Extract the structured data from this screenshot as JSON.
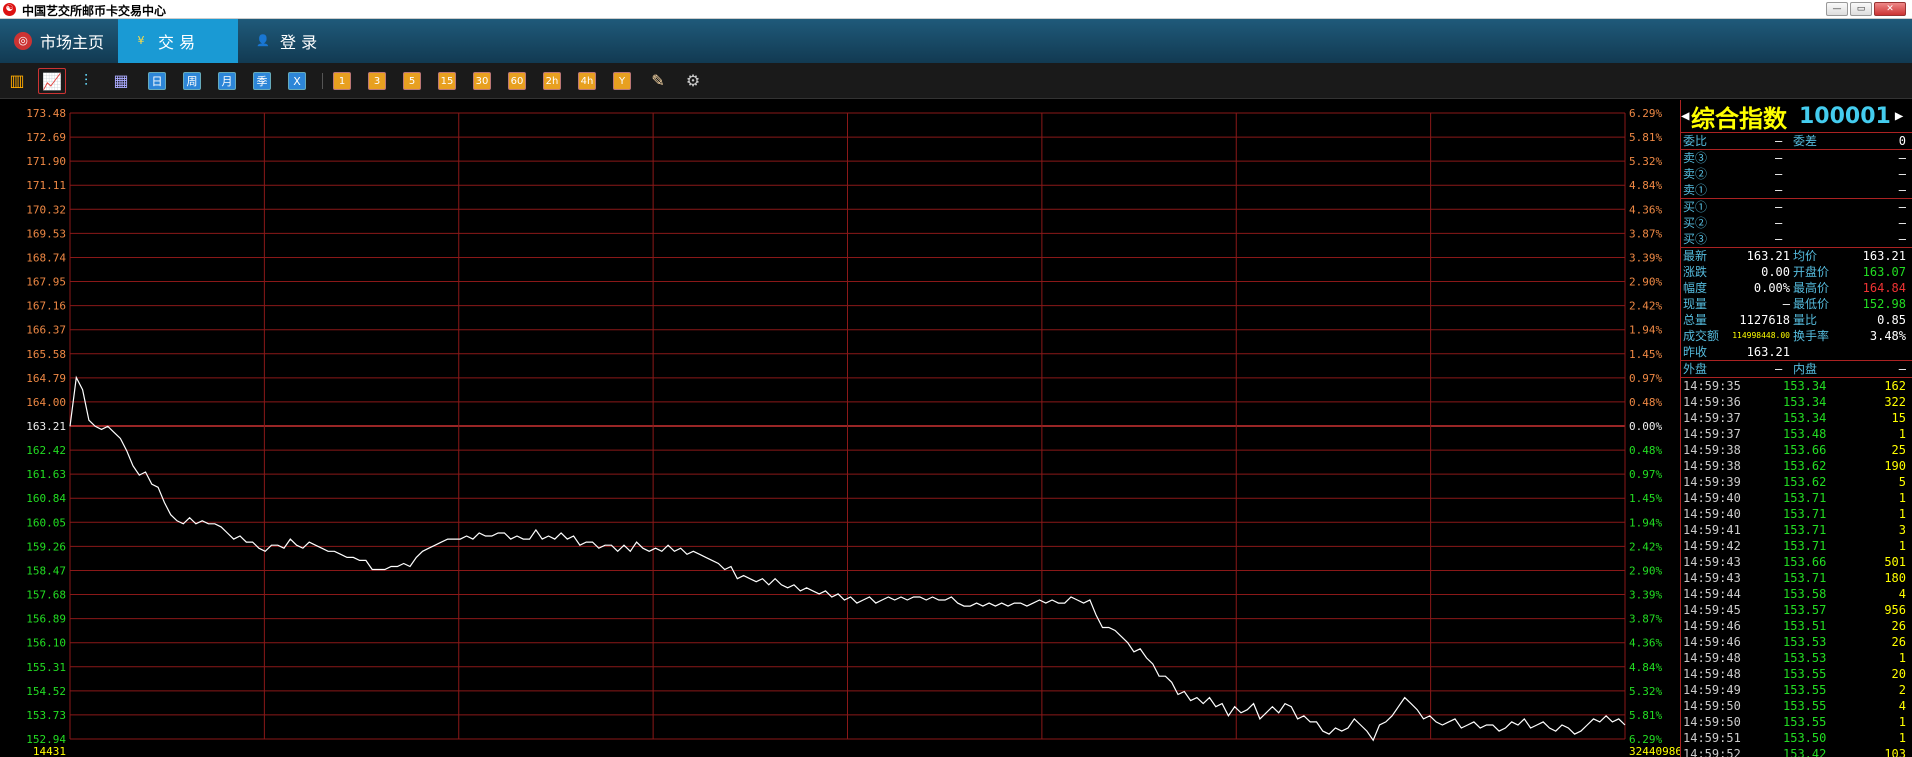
{
  "window": {
    "title": "中国艺交所邮币卡交易中心",
    "buttons": [
      "—",
      "▭",
      "✕"
    ]
  },
  "nav": {
    "items": [
      {
        "label": "市场主页",
        "icon": "market-icon",
        "active": false
      },
      {
        "label": "交 易",
        "icon": "yen-icon",
        "active": true
      },
      {
        "label": "登 录",
        "icon": "user-icon",
        "active": false
      }
    ]
  },
  "toolbar": {
    "icons": [
      {
        "name": "bar-chart-icon",
        "glyph": "▥"
      },
      {
        "name": "line-chart-icon",
        "glyph": "📈",
        "selected": true
      },
      {
        "name": "candlestick-icon",
        "glyph": "⫶"
      },
      {
        "name": "calendar-icon",
        "glyph": "▦"
      }
    ],
    "periods": [
      "日",
      "周",
      "月",
      "季",
      "X"
    ],
    "minutes": [
      "1",
      "3",
      "5",
      "15",
      "30",
      "60",
      "2h",
      "4h",
      "Y"
    ],
    "extra": [
      {
        "name": "draw-icon",
        "glyph": "✎"
      },
      {
        "name": "gear-icon",
        "glyph": "⚙"
      }
    ]
  },
  "panel": {
    "name": "综合指数",
    "code": "100001",
    "weibi": {
      "label1": "委比",
      "val1": "—",
      "label2": "委差",
      "val2": "0"
    },
    "sell": [
      {
        "label": "卖③",
        "price": "—",
        "vol": "—"
      },
      {
        "label": "卖②",
        "price": "—",
        "vol": "—"
      },
      {
        "label": "卖①",
        "price": "—",
        "vol": "—"
      }
    ],
    "buy": [
      {
        "label": "买①",
        "price": "—",
        "vol": "—"
      },
      {
        "label": "买②",
        "price": "—",
        "vol": "—"
      },
      {
        "label": "买③",
        "price": "—",
        "vol": "—"
      }
    ],
    "stats": [
      {
        "l1": "最新",
        "v1": "163.21",
        "l2": "均价",
        "v2": "163.21",
        "c2": "val-w"
      },
      {
        "l1": "涨跌",
        "v1": "0.00",
        "l2": "开盘价",
        "v2": "163.07",
        "c2": "val-g"
      },
      {
        "l1": "幅度",
        "v1": "0.00%",
        "l2": "最高价",
        "v2": "164.84",
        "c2": "val-r"
      },
      {
        "l1": "现量",
        "v1": "—",
        "l2": "最低价",
        "v2": "152.98",
        "c2": "val-g"
      },
      {
        "l1": "总量",
        "v1": "1127618",
        "l2": "量比",
        "v2": "0.85",
        "c2": "val-w"
      },
      {
        "l1": "成交额",
        "v1": "114998448.00",
        "l2": "换手率",
        "v2": "3.48%",
        "c2": "val-w"
      },
      {
        "l1": "昨收",
        "v1": "163.21",
        "l2": "",
        "v2": "",
        "c2": "val-w"
      }
    ],
    "outer_inner": {
      "l1": "外盘",
      "v1": "—",
      "l2": "内盘",
      "v2": "—"
    },
    "ticks": [
      {
        "time": "14:59:35",
        "price": "153.34",
        "vol": "162"
      },
      {
        "time": "14:59:36",
        "price": "153.34",
        "vol": "322"
      },
      {
        "time": "14:59:37",
        "price": "153.34",
        "vol": "15"
      },
      {
        "time": "14:59:37",
        "price": "153.48",
        "vol": "1"
      },
      {
        "time": "14:59:38",
        "price": "153.66",
        "vol": "25"
      },
      {
        "time": "14:59:38",
        "price": "153.62",
        "vol": "190"
      },
      {
        "time": "14:59:39",
        "price": "153.62",
        "vol": "5"
      },
      {
        "time": "14:59:40",
        "price": "153.71",
        "vol": "1"
      },
      {
        "time": "14:59:40",
        "price": "153.71",
        "vol": "1"
      },
      {
        "time": "14:59:41",
        "price": "153.71",
        "vol": "3"
      },
      {
        "time": "14:59:42",
        "price": "153.71",
        "vol": "1"
      },
      {
        "time": "14:59:43",
        "price": "153.66",
        "vol": "501"
      },
      {
        "time": "14:59:43",
        "price": "153.71",
        "vol": "180"
      },
      {
        "time": "14:59:44",
        "price": "153.58",
        "vol": "4"
      },
      {
        "time": "14:59:45",
        "price": "153.57",
        "vol": "956"
      },
      {
        "time": "14:59:46",
        "price": "153.51",
        "vol": "26"
      },
      {
        "time": "14:59:46",
        "price": "153.53",
        "vol": "26"
      },
      {
        "time": "14:59:48",
        "price": "153.53",
        "vol": "1"
      },
      {
        "time": "14:59:48",
        "price": "153.55",
        "vol": "20"
      },
      {
        "time": "14:59:49",
        "price": "153.55",
        "vol": "2"
      },
      {
        "time": "14:59:50",
        "price": "153.55",
        "vol": "4"
      },
      {
        "time": "14:59:50",
        "price": "153.55",
        "vol": "1"
      },
      {
        "time": "14:59:51",
        "price": "153.50",
        "vol": "1"
      },
      {
        "time": "14:59:52",
        "price": "153.42",
        "vol": "103"
      }
    ]
  },
  "chart_data": {
    "type": "line",
    "prev_close": 163.21,
    "ylim": [
      152.94,
      173.48
    ],
    "y_ticks": [
      "173.48",
      "172.69",
      "171.90",
      "171.11",
      "170.32",
      "169.53",
      "168.74",
      "167.95",
      "167.16",
      "166.37",
      "165.58",
      "164.79",
      "164.00",
      "163.21",
      "162.42",
      "161.63",
      "160.84",
      "160.05",
      "159.26",
      "158.47",
      "157.68",
      "156.89",
      "156.10",
      "155.31",
      "154.52",
      "153.73",
      "152.94"
    ],
    "pct_ticks": [
      "6.29%",
      "5.81%",
      "5.32%",
      "4.84%",
      "4.36%",
      "3.87%",
      "3.39%",
      "2.90%",
      "2.42%",
      "1.94%",
      "1.45%",
      "0.97%",
      "0.48%",
      "0.00%",
      "0.48%",
      "0.97%",
      "1.45%",
      "1.94%",
      "2.42%",
      "2.90%",
      "3.39%",
      "3.87%",
      "4.36%",
      "4.84%",
      "5.32%",
      "5.81%",
      "6.29%"
    ],
    "bottom_left": "14431",
    "bottom_right": "32440986",
    "v_grid_count": 8,
    "values": [
      163.2,
      164.8,
      164.4,
      163.4,
      163.2,
      163.1,
      163.2,
      163.0,
      162.8,
      162.4,
      161.9,
      161.6,
      161.7,
      161.3,
      161.2,
      160.7,
      160.3,
      160.1,
      160.0,
      160.2,
      160.0,
      160.1,
      160.0,
      160.0,
      159.9,
      159.7,
      159.5,
      159.6,
      159.4,
      159.4,
      159.2,
      159.1,
      159.3,
      159.3,
      159.2,
      159.5,
      159.3,
      159.2,
      159.4,
      159.3,
      159.2,
      159.1,
      159.1,
      159.0,
      158.9,
      158.9,
      158.8,
      158.8,
      158.5,
      158.5,
      158.5,
      158.6,
      158.6,
      158.7,
      158.6,
      158.9,
      159.1,
      159.2,
      159.3,
      159.4,
      159.5,
      159.5,
      159.5,
      159.6,
      159.5,
      159.7,
      159.6,
      159.6,
      159.7,
      159.7,
      159.5,
      159.6,
      159.5,
      159.5,
      159.8,
      159.5,
      159.6,
      159.5,
      159.7,
      159.5,
      159.6,
      159.3,
      159.4,
      159.4,
      159.2,
      159.3,
      159.3,
      159.1,
      159.3,
      159.1,
      159.4,
      159.2,
      159.1,
      159.2,
      159.1,
      159.3,
      159.1,
      159.2,
      159.0,
      159.1,
      159.0,
      158.9,
      158.8,
      158.7,
      158.5,
      158.6,
      158.2,
      158.3,
      158.2,
      158.1,
      158.2,
      158.0,
      158.2,
      158.0,
      157.9,
      158.0,
      157.8,
      157.9,
      157.8,
      157.7,
      157.8,
      157.6,
      157.7,
      157.5,
      157.6,
      157.4,
      157.5,
      157.6,
      157.4,
      157.5,
      157.6,
      157.5,
      157.6,
      157.5,
      157.6,
      157.6,
      157.5,
      157.6,
      157.5,
      157.5,
      157.6,
      157.4,
      157.3,
      157.3,
      157.4,
      157.3,
      157.4,
      157.3,
      157.4,
      157.3,
      157.4,
      157.4,
      157.3,
      157.4,
      157.5,
      157.4,
      157.5,
      157.4,
      157.4,
      157.6,
      157.5,
      157.4,
      157.5,
      157.0,
      156.6,
      156.6,
      156.5,
      156.3,
      156.1,
      155.8,
      155.9,
      155.6,
      155.4,
      155.0,
      155.0,
      154.8,
      154.4,
      154.5,
      154.2,
      154.3,
      154.1,
      154.3,
      154.0,
      154.1,
      153.7,
      154.0,
      153.8,
      153.9,
      154.1,
      153.6,
      153.8,
      154.0,
      153.8,
      154.1,
      154.0,
      153.6,
      153.7,
      153.5,
      153.5,
      153.2,
      153.1,
      153.3,
      153.2,
      153.3,
      153.6,
      153.4,
      153.2,
      152.9,
      153.4,
      153.5,
      153.7,
      154.0,
      154.3,
      154.1,
      153.9,
      153.6,
      153.7,
      153.5,
      153.4,
      153.5,
      153.6,
      153.3,
      153.4,
      153.5,
      153.3,
      153.4,
      153.4,
      153.2,
      153.3,
      153.5,
      153.4,
      153.6,
      153.3,
      153.4,
      153.5,
      153.3,
      153.2,
      153.4,
      153.3,
      153.1,
      153.2,
      153.4,
      153.6,
      153.5,
      153.7,
      153.5,
      153.6,
      153.4
    ]
  }
}
